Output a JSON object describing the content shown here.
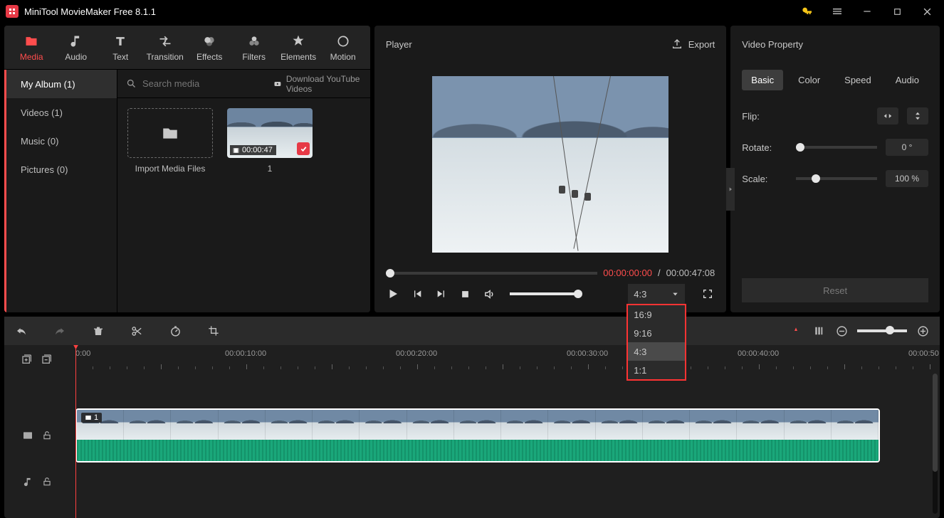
{
  "app": {
    "title": "MiniTool MovieMaker Free 8.1.1"
  },
  "toolbar": {
    "tabs": [
      {
        "id": "media",
        "label": "Media"
      },
      {
        "id": "audio",
        "label": "Audio"
      },
      {
        "id": "text",
        "label": "Text"
      },
      {
        "id": "transition",
        "label": "Transition"
      },
      {
        "id": "effects",
        "label": "Effects"
      },
      {
        "id": "filters",
        "label": "Filters"
      },
      {
        "id": "elements",
        "label": "Elements"
      },
      {
        "id": "motion",
        "label": "Motion"
      }
    ],
    "active": "media"
  },
  "sidebar": {
    "items": [
      {
        "id": "myalbum",
        "label": "My Album (1)"
      },
      {
        "id": "videos",
        "label": "Videos (1)"
      },
      {
        "id": "music",
        "label": "Music (0)"
      },
      {
        "id": "pictures",
        "label": "Pictures (0)"
      }
    ],
    "active": "myalbum"
  },
  "media": {
    "search_placeholder": "Search media",
    "download_label": "Download YouTube Videos",
    "import_label": "Import Media Files",
    "clip": {
      "duration": "00:00:47",
      "index": "1"
    }
  },
  "player": {
    "title": "Player",
    "export_label": "Export",
    "current": "00:00:00:00",
    "total": "00:00:47:08",
    "sep": " / ",
    "aspect_selected": "4:3",
    "aspect_options": [
      "16:9",
      "9:16",
      "4:3",
      "1:1"
    ]
  },
  "props": {
    "title": "Video Property",
    "tabs": [
      "Basic",
      "Color",
      "Speed",
      "Audio"
    ],
    "active": "Basic",
    "flip_label": "Flip:",
    "rotate_label": "Rotate:",
    "rotate_value": "0 °",
    "scale_label": "Scale:",
    "scale_value": "100 %",
    "reset_label": "Reset"
  },
  "timeline": {
    "ruler": [
      "0:00",
      "00:00:10:00",
      "00:00:20:00",
      "00:00:30:00",
      "00:00:40:00",
      "00:00:50"
    ],
    "clip_badge": "1"
  }
}
